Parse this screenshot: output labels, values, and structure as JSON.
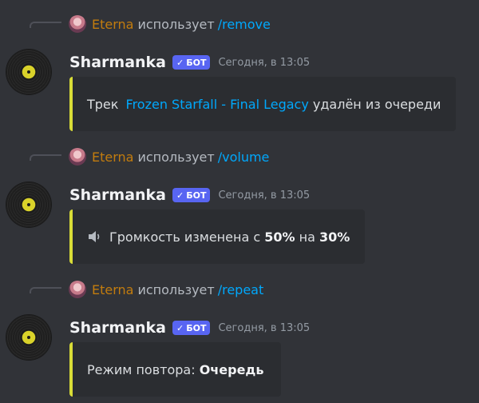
{
  "messages": [
    {
      "reply": {
        "user": "Eterna",
        "action": "использует",
        "command": "/remove"
      },
      "author": "Sharmanka",
      "badge": "БОТ",
      "timestamp": "Сегодня, в 13:05",
      "embed": {
        "prefix": "Трек ",
        "track": "Frozen Starfall - Final Legacy",
        "suffix": " удалён из очереди",
        "accent": "#d8dc37"
      }
    },
    {
      "reply": {
        "user": "Eterna",
        "action": "использует",
        "command": "/volume"
      },
      "author": "Sharmanka",
      "badge": "БОТ",
      "timestamp": "Сегодня, в 13:05",
      "embed": {
        "icon": "speaker-icon",
        "prefix": "Громкость изменена с ",
        "old_value": "50%",
        "middle": " на ",
        "new_value": "30%",
        "accent": "#d8dc37"
      }
    },
    {
      "reply": {
        "user": "Eterna",
        "action": "использует",
        "command": "/repeat"
      },
      "author": "Sharmanka",
      "badge": "БОТ",
      "timestamp": "Сегодня, в 13:05",
      "embed": {
        "prefix": "Режим повтора: ",
        "mode": "Очередь",
        "accent": "#d8dc37"
      }
    }
  ],
  "colors": {
    "background": "#313338",
    "embed_bg": "#2b2d31",
    "reply_user": "#c27c0e",
    "link": "#00a8fc",
    "bot_badge": "#5865f2"
  }
}
